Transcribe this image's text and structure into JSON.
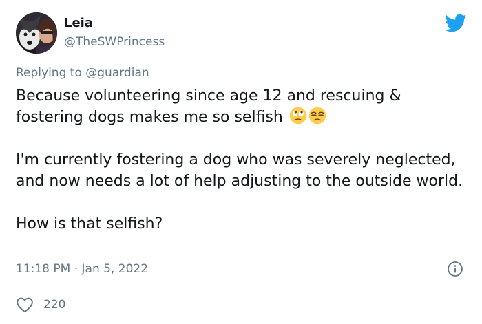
{
  "author": {
    "display_name": "Leia",
    "handle": "@TheSWPrincess"
  },
  "reply": {
    "prefix": "Replying to ",
    "mention": "@guardian"
  },
  "body": {
    "paragraph_1": "Because volunteering since age 12 and rescuing & fostering dogs makes me so selfish",
    "paragraph_1_emojis": [
      "face-with-rolling-eyes-icon",
      "unamused-face-icon"
    ],
    "paragraph_2": "I'm currently fostering a dog who was severely neglected, and now needs a lot of help adjusting to the outside world.",
    "paragraph_3": "How is that selfish?"
  },
  "meta": {
    "time": "11:18 PM",
    "separator": " · ",
    "date": "Jan 5, 2022"
  },
  "engagement": {
    "likes": "220"
  },
  "icons": {
    "brand": "twitter-bird-icon",
    "info": "info-icon",
    "like": "heart-icon"
  },
  "colors": {
    "brand_blue": "#1da1f2",
    "secondary_text": "#657786",
    "primary_text": "#14171a",
    "divider": "#e1e8ed"
  }
}
